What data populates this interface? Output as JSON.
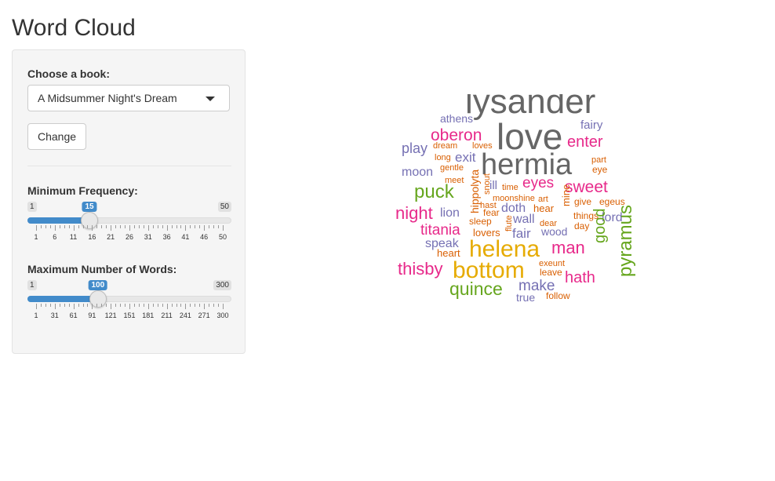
{
  "page": {
    "title": "Word Cloud"
  },
  "sidebar": {
    "book_label": "Choose a book:",
    "book_selected": "A Midsummer Night's Dream",
    "change_button": "Change",
    "min_freq": {
      "label": "Minimum Frequency:",
      "min": 1,
      "max": 50,
      "value": 15,
      "min_label": "1",
      "max_label": "50",
      "value_label": "15",
      "tick_labels": [
        "1",
        "6",
        "11",
        "16",
        "21",
        "26",
        "31",
        "36",
        "41",
        "46",
        "50"
      ]
    },
    "max_words": {
      "label": "Maximum Number of Words:",
      "min": 1,
      "max": 300,
      "value": 100,
      "min_label": "1",
      "max_label": "300",
      "value_label": "100",
      "tick_labels": [
        "1",
        "31",
        "61",
        "91",
        "121",
        "151",
        "181",
        "211",
        "241",
        "271",
        "300"
      ]
    }
  },
  "wordcloud": {
    "colors": {
      "gray": "#666666",
      "purple": "#7570b3",
      "pink": "#e7298a",
      "green": "#66a61e",
      "gold": "#e6ab02",
      "orange": "#d95f02"
    },
    "words": [
      {
        "text": "lysander",
        "color": "gray"
      },
      {
        "text": "love",
        "color": "gray"
      },
      {
        "text": "hermia",
        "color": "gray"
      },
      {
        "text": "athens",
        "color": "purple"
      },
      {
        "text": "fairy",
        "color": "purple"
      },
      {
        "text": "oberon",
        "color": "pink"
      },
      {
        "text": "enter",
        "color": "pink"
      },
      {
        "text": "play",
        "color": "purple"
      },
      {
        "text": "dream",
        "color": "orange"
      },
      {
        "text": "loves",
        "color": "orange"
      },
      {
        "text": "exit",
        "color": "purple"
      },
      {
        "text": "long",
        "color": "orange"
      },
      {
        "text": "part",
        "color": "orange"
      },
      {
        "text": "moon",
        "color": "purple"
      },
      {
        "text": "gentle",
        "color": "orange"
      },
      {
        "text": "eye",
        "color": "orange"
      },
      {
        "text": "meet",
        "color": "orange"
      },
      {
        "text": "ill",
        "color": "purple"
      },
      {
        "text": "time",
        "color": "orange"
      },
      {
        "text": "eyes",
        "color": "pink"
      },
      {
        "text": "sweet",
        "color": "pink"
      },
      {
        "text": "puck",
        "color": "green"
      },
      {
        "text": "hippolyta",
        "color": "orange"
      },
      {
        "text": "snout",
        "color": "orange"
      },
      {
        "text": "moonshine",
        "color": "orange"
      },
      {
        "text": "art",
        "color": "orange"
      },
      {
        "text": "give",
        "color": "orange"
      },
      {
        "text": "egeus",
        "color": "orange"
      },
      {
        "text": "night",
        "color": "pink"
      },
      {
        "text": "lion",
        "color": "purple"
      },
      {
        "text": "hast",
        "color": "orange"
      },
      {
        "text": "doth",
        "color": "purple"
      },
      {
        "text": "hear",
        "color": "orange"
      },
      {
        "text": "mine",
        "color": "orange"
      },
      {
        "text": "things",
        "color": "orange"
      },
      {
        "text": "lord",
        "color": "purple"
      },
      {
        "text": "fear",
        "color": "orange"
      },
      {
        "text": "wall",
        "color": "purple"
      },
      {
        "text": "sleep",
        "color": "orange"
      },
      {
        "text": "flute",
        "color": "orange"
      },
      {
        "text": "dear",
        "color": "orange"
      },
      {
        "text": "day",
        "color": "orange"
      },
      {
        "text": "titania",
        "color": "pink"
      },
      {
        "text": "lovers",
        "color": "orange"
      },
      {
        "text": "fair",
        "color": "purple"
      },
      {
        "text": "wood",
        "color": "purple"
      },
      {
        "text": "good",
        "color": "green"
      },
      {
        "text": "speak",
        "color": "purple"
      },
      {
        "text": "helena",
        "color": "gold"
      },
      {
        "text": "man",
        "color": "pink"
      },
      {
        "text": "heart",
        "color": "orange"
      },
      {
        "text": "pyramus",
        "color": "green"
      },
      {
        "text": "exeunt",
        "color": "orange"
      },
      {
        "text": "thisby",
        "color": "pink"
      },
      {
        "text": "bottom",
        "color": "gold"
      },
      {
        "text": "leave",
        "color": "orange"
      },
      {
        "text": "hath",
        "color": "pink"
      },
      {
        "text": "quince",
        "color": "green"
      },
      {
        "text": "make",
        "color": "purple"
      },
      {
        "text": "true",
        "color": "purple"
      },
      {
        "text": "follow",
        "color": "orange"
      }
    ]
  }
}
